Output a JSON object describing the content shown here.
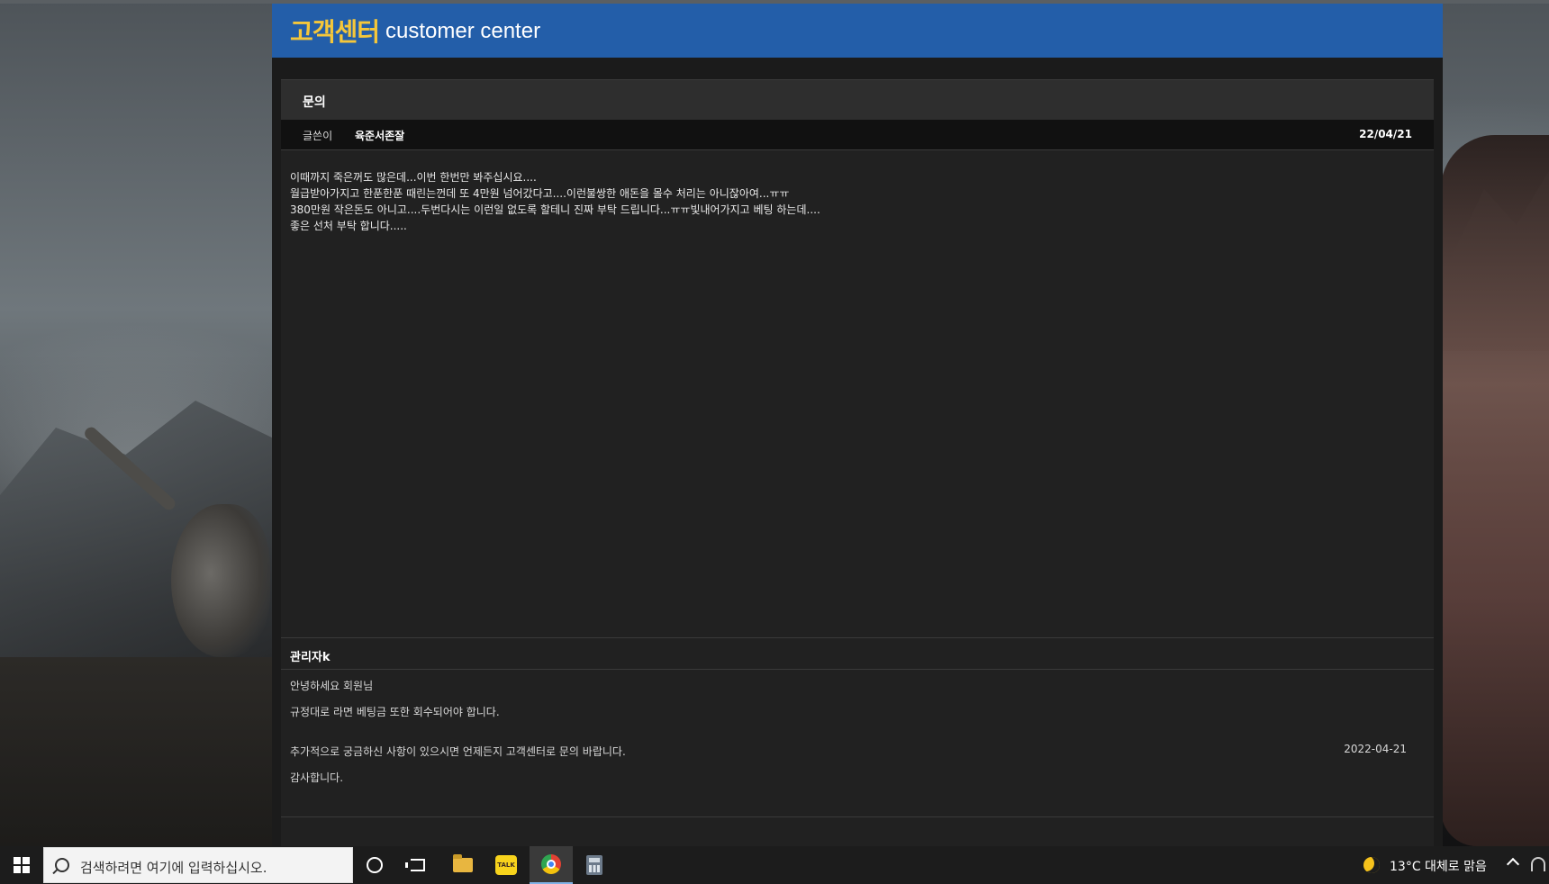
{
  "header": {
    "title_ko": "고객센터",
    "title_en": "customer center"
  },
  "board": {
    "title": "문의",
    "meta_label": "글쓴이",
    "author": "육준서존잘",
    "date": "22/04/21",
    "body_lines": [
      "이때까지 죽은꺼도 많은데...이번 한번만 봐주십시요....",
      "월급받아가지고 한푼한푼 때린는껀데 또 4만원 넘어갔다고....이런불쌍한 애돈을 몰수 처리는 아니잖아여...ㅠㅠ",
      "380만원 작은돈도 아니고....두번다시는 이런일 없도록 할테니 진짜 부탁 드립니다...ㅠㅠ빛내어가지고 베팅 하는데....",
      "좋은 선처 부탁 합니다....."
    ]
  },
  "reply": {
    "author": "관리자k",
    "lines": [
      "안녕하세요 회원님",
      "규정대로 라면 베팅금 또한 회수되어야 합니다.",
      "추가적으로 궁금하신 사항이 있으시면 언제든지 고객센터로 문의 바랍니다.",
      "감사합니다."
    ],
    "date": "2022-04-21"
  },
  "taskbar": {
    "search_placeholder": "검색하려면 여기에 입력하십시오.",
    "kakao_label": "TALK",
    "weather": "13°C  대체로 맑음",
    "icons": [
      "windows-start-icon",
      "search-icon",
      "cortana-icon",
      "task-view-icon",
      "file-explorer-icon",
      "kakaotalk-icon",
      "chrome-icon",
      "calculator-icon",
      "weather-icon",
      "chevron-up-icon",
      "network-icon"
    ]
  },
  "colors": {
    "header_bg": "#235ea9",
    "header_title": "#f5c73a",
    "board_bg": "#212121",
    "taskbar_bg": "#1c1c1c"
  }
}
